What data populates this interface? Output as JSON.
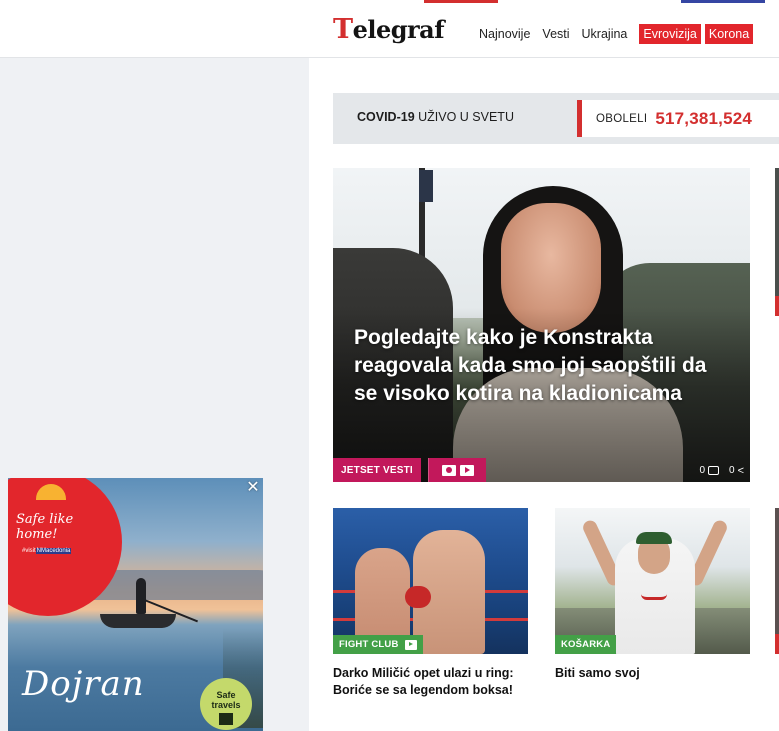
{
  "header": {
    "logo_text": "Telegraf",
    "logo_first_letter": "T",
    "logo_rest": "elegraf",
    "nav": {
      "najnovije": "Najnovije",
      "vesti": "Vesti",
      "ukrajina": "Ukrajina",
      "evrovizija": "Evrovizija",
      "korona": "Korona"
    }
  },
  "covid": {
    "title_bold": "COVID-19",
    "title_rest": " UŽIVO U SVETU",
    "label": "OBOLELI",
    "value": "517,381,524"
  },
  "hero": {
    "title": "Pogledajte kako je Konstrakta reagovala kada smo joj saopštili da se visoko kotira na kladionicama",
    "tag": "JETSET VESTI",
    "comments": "0",
    "shares": "0",
    "icons": [
      "photo-icon",
      "play-icon"
    ]
  },
  "cards": [
    {
      "tag": "FIGHT CLUB",
      "title": "Darko Miličić opet ulazi u ring: Boriće se sa legendom boksa!",
      "has_video": true
    },
    {
      "tag": "KOŠARKA",
      "title": "Biti samo svoj",
      "has_video": false
    }
  ],
  "ad": {
    "slogan": "Safe like home!",
    "handle_prefix": "#visit",
    "handle_tag": "NMacedonia",
    "city": "Dojran",
    "safe_badge_line1": "Safe",
    "safe_badge_line2": "travels",
    "close_symbol": "✕"
  },
  "colors": {
    "brand_red": "#d32f2f",
    "nav_badge_red": "#e2262c",
    "jetset_pink": "#c2185b",
    "sport_green": "#43a047",
    "rail_gray": "#eff1f4"
  }
}
